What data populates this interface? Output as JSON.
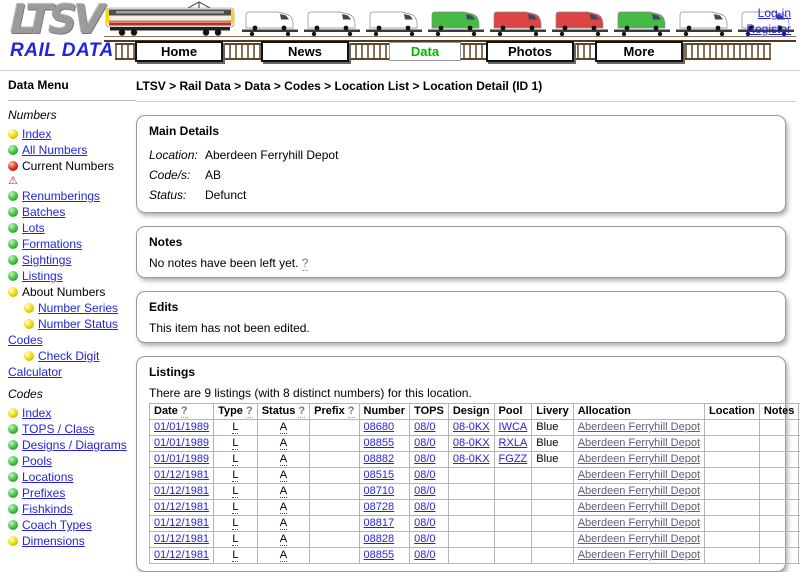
{
  "header": {
    "logo_title": "LTSV",
    "logo_subtitle": "RAIL DATA",
    "auth": {
      "login": "Log-in",
      "register": "Register"
    },
    "nav": [
      {
        "label": "Home",
        "active": false
      },
      {
        "label": "News",
        "active": false
      },
      {
        "label": "Data",
        "active": true
      },
      {
        "label": "Photos",
        "active": false
      },
      {
        "label": "More",
        "active": false
      }
    ],
    "active_nav_color": "#00b400",
    "banner_vans": [
      "#ffffff",
      "#ffffff",
      "#ffffff",
      "#44bb44",
      "#dd4444",
      "#dd4444",
      "#44bb44",
      "#ffffff",
      "#ffffff"
    ]
  },
  "sidebar": {
    "title": "Data Menu",
    "sections": [
      {
        "header": "Numbers",
        "items": [
          {
            "ball": "yellow",
            "label": "Index",
            "link": true
          },
          {
            "ball": "green",
            "label": "All Numbers",
            "link": true
          },
          {
            "ball": "red",
            "label": "Current Numbers",
            "link": false
          },
          {
            "ball": "warning",
            "label": "",
            "link": false
          },
          {
            "ball": "green",
            "label": "Renumberings",
            "link": true
          },
          {
            "ball": "green",
            "label": "Batches",
            "link": true
          },
          {
            "ball": "green",
            "label": "Lots",
            "link": true
          },
          {
            "ball": "green",
            "label": "Formations",
            "link": true
          },
          {
            "ball": "green",
            "label": "Sightings",
            "link": true
          },
          {
            "ball": "green",
            "label": "Listings",
            "link": true
          },
          {
            "ball": "yellow",
            "label": "About Numbers",
            "link": false
          },
          {
            "ball": "yellow",
            "label": "Number Series",
            "link": true,
            "indent": true
          },
          {
            "ball": "yellow",
            "label": "Number Status Codes",
            "link": true,
            "indent": true
          },
          {
            "ball": "yellow",
            "label": "Check Digit Calculator",
            "link": true,
            "indent": true
          }
        ]
      },
      {
        "header": "Codes",
        "items": [
          {
            "ball": "yellow",
            "label": "Index",
            "link": true
          },
          {
            "ball": "green",
            "label": "TOPS / Class",
            "link": true
          },
          {
            "ball": "green",
            "label": "Designs / Diagrams",
            "link": true
          },
          {
            "ball": "green",
            "label": "Pools",
            "link": true
          },
          {
            "ball": "green",
            "label": "Locations",
            "link": true
          },
          {
            "ball": "green",
            "label": "Prefixes",
            "link": true
          },
          {
            "ball": "green",
            "label": "Fishkinds",
            "link": true
          },
          {
            "ball": "green",
            "label": "Coach Types",
            "link": true
          },
          {
            "ball": "yellow",
            "label": "Dimensions",
            "link": true
          }
        ]
      }
    ]
  },
  "breadcrumb": "LTSV > Rail Data > Data > Codes > Location List > Location Detail (ID 1)",
  "main_details": {
    "title": "Main Details",
    "fields": [
      {
        "label": "Location:",
        "value": "Aberdeen Ferryhill Depot"
      },
      {
        "label": "Code/s:",
        "value": "AB"
      },
      {
        "label": "Status:",
        "value": "Defunct"
      }
    ]
  },
  "notes": {
    "title": "Notes",
    "text": "No notes have been left yet.",
    "help": "?"
  },
  "edits": {
    "title": "Edits",
    "text": "This item has not been edited."
  },
  "listings": {
    "title": "Listings",
    "summary": "There are 9 listings (with 8 distinct numbers) for this location.",
    "columns": [
      {
        "label": "Date",
        "help": true
      },
      {
        "label": "Type",
        "help": true
      },
      {
        "label": "Status",
        "help": true
      },
      {
        "label": "Prefix",
        "help": true
      },
      {
        "label": "Number",
        "help": false
      },
      {
        "label": "TOPS",
        "help": false
      },
      {
        "label": "Design",
        "help": false
      },
      {
        "label": "Pool",
        "help": false
      },
      {
        "label": "Livery",
        "help": false
      },
      {
        "label": "Allocation",
        "help": false
      },
      {
        "label": "Location",
        "help": false
      },
      {
        "label": "Notes",
        "help": false
      },
      {
        "label": "?",
        "help": false,
        "is_help": true
      }
    ],
    "rows": [
      [
        "01/01/1989",
        "L",
        "A",
        "",
        "08680",
        "08/0",
        "08-0KX",
        "IWCA",
        "Blue",
        "Aberdeen Ferryhill Depot",
        "",
        "",
        "green"
      ],
      [
        "01/01/1989",
        "L",
        "A",
        "",
        "08855",
        "08/0",
        "08-0KX",
        "RXLA",
        "Blue",
        "Aberdeen Ferryhill Depot",
        "",
        "",
        "green"
      ],
      [
        "01/01/1989",
        "L",
        "A",
        "",
        "08882",
        "08/0",
        "08-0KX",
        "FGZZ",
        "Blue",
        "Aberdeen Ferryhill Depot",
        "",
        "",
        "green"
      ],
      [
        "01/12/1981",
        "L",
        "A",
        "",
        "08515",
        "08/0",
        "",
        "",
        "",
        "Aberdeen Ferryhill Depot",
        "",
        "",
        "green"
      ],
      [
        "01/12/1981",
        "L",
        "A",
        "",
        "08710",
        "08/0",
        "",
        "",
        "",
        "Aberdeen Ferryhill Depot",
        "",
        "",
        "green"
      ],
      [
        "01/12/1981",
        "L",
        "A",
        "",
        "08728",
        "08/0",
        "",
        "",
        "",
        "Aberdeen Ferryhill Depot",
        "",
        "",
        "green"
      ],
      [
        "01/12/1981",
        "L",
        "A",
        "",
        "08817",
        "08/0",
        "",
        "",
        "",
        "Aberdeen Ferryhill Depot",
        "",
        "",
        "green"
      ],
      [
        "01/12/1981",
        "L",
        "A",
        "",
        "08828",
        "08/0",
        "",
        "",
        "",
        "Aberdeen Ferryhill Depot",
        "",
        "",
        "green"
      ],
      [
        "01/12/1981",
        "L",
        "A",
        "",
        "08855",
        "08/0",
        "",
        "",
        "",
        "Aberdeen Ferryhill Depot",
        "",
        "",
        "green"
      ]
    ]
  }
}
